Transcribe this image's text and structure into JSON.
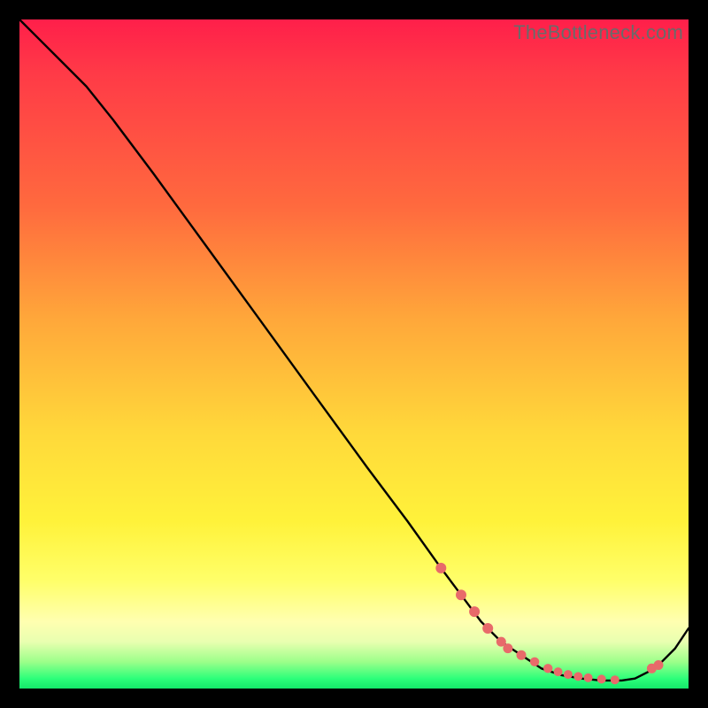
{
  "watermark": "TheBottleneck.com",
  "colors": {
    "page_bg": "#000000",
    "dot": "#e86a6a",
    "line": "#000000"
  },
  "chart_data": {
    "type": "line",
    "title": "",
    "xlabel": "",
    "ylabel": "",
    "xlim": [
      0,
      100
    ],
    "ylim": [
      0,
      100
    ],
    "grid": false,
    "legend": false,
    "series": [
      {
        "name": "curve",
        "x": [
          0,
          3,
          6,
          10,
          14,
          20,
          28,
          36,
          44,
          52,
          58,
          63,
          66,
          69,
          72,
          75,
          78,
          81,
          84,
          87,
          90,
          92,
          94,
          96,
          98,
          100
        ],
        "y": [
          100,
          97,
          94,
          90,
          85,
          77,
          66,
          55,
          44,
          33,
          25,
          18,
          14,
          10,
          7,
          5,
          3,
          2,
          1.5,
          1.2,
          1.2,
          1.5,
          2.5,
          4,
          6,
          9
        ]
      }
    ],
    "markers": {
      "name": "highlight-dots",
      "x": [
        63,
        66,
        68,
        70,
        72,
        73,
        75,
        77,
        79,
        80.5,
        82,
        83.5,
        85,
        87,
        89,
        94.5,
        95.5
      ],
      "y": [
        18,
        14,
        11.5,
        9,
        7,
        6,
        5,
        4,
        3,
        2.5,
        2.1,
        1.8,
        1.6,
        1.4,
        1.3,
        3.0,
        3.5
      ],
      "r": [
        6,
        6,
        6,
        6,
        5.5,
        5.5,
        5.5,
        5.2,
        5.2,
        5,
        5,
        5,
        5,
        5,
        5,
        5.5,
        5.5
      ]
    }
  }
}
